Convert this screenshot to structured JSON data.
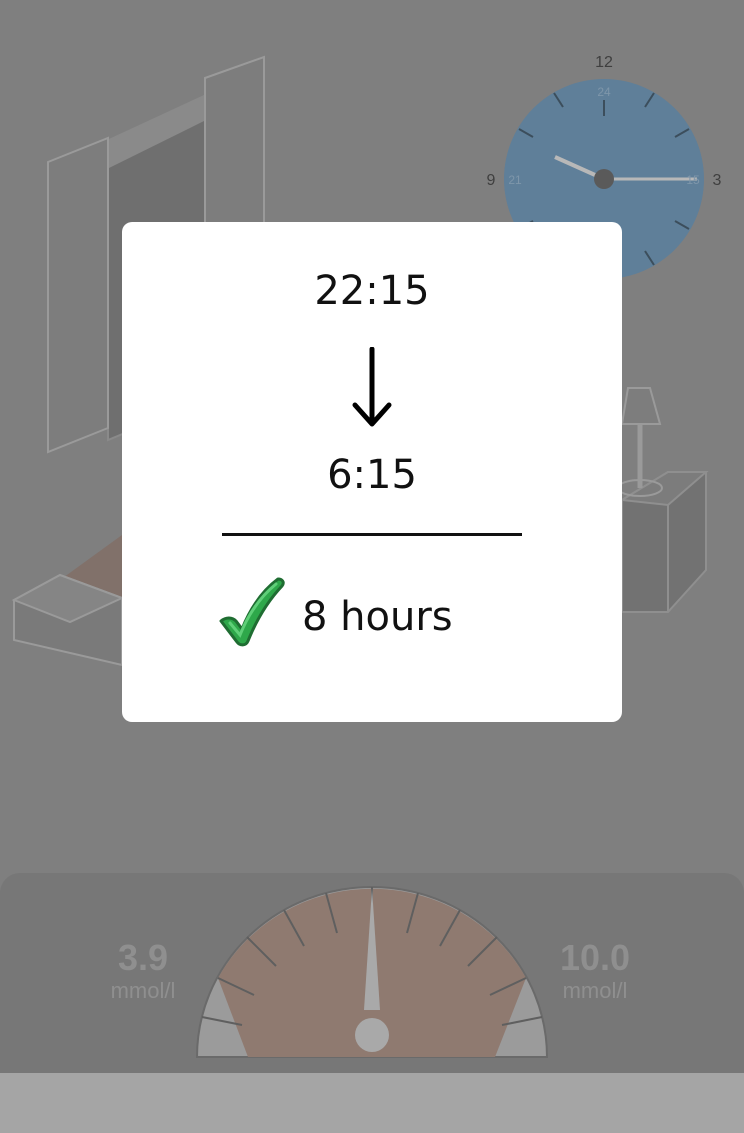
{
  "clock": {
    "outer_numbers": [
      "12",
      "3",
      "9"
    ],
    "inner_numbers": [
      "24",
      "15",
      "21"
    ],
    "face_color": "#5f7f99"
  },
  "glucose_gauge": {
    "low": {
      "value": "3.9",
      "unit": "mmol/l"
    },
    "high": {
      "value": "10.0",
      "unit": "mmol/l"
    },
    "range_color": "#8f7a70"
  },
  "sleep_dialog": {
    "bedtime": "22:15",
    "wake_time": "6:15",
    "duration": "8 hours",
    "status_icon": "green-checkmark-icon",
    "arrow_icon": "down-arrow-icon"
  }
}
